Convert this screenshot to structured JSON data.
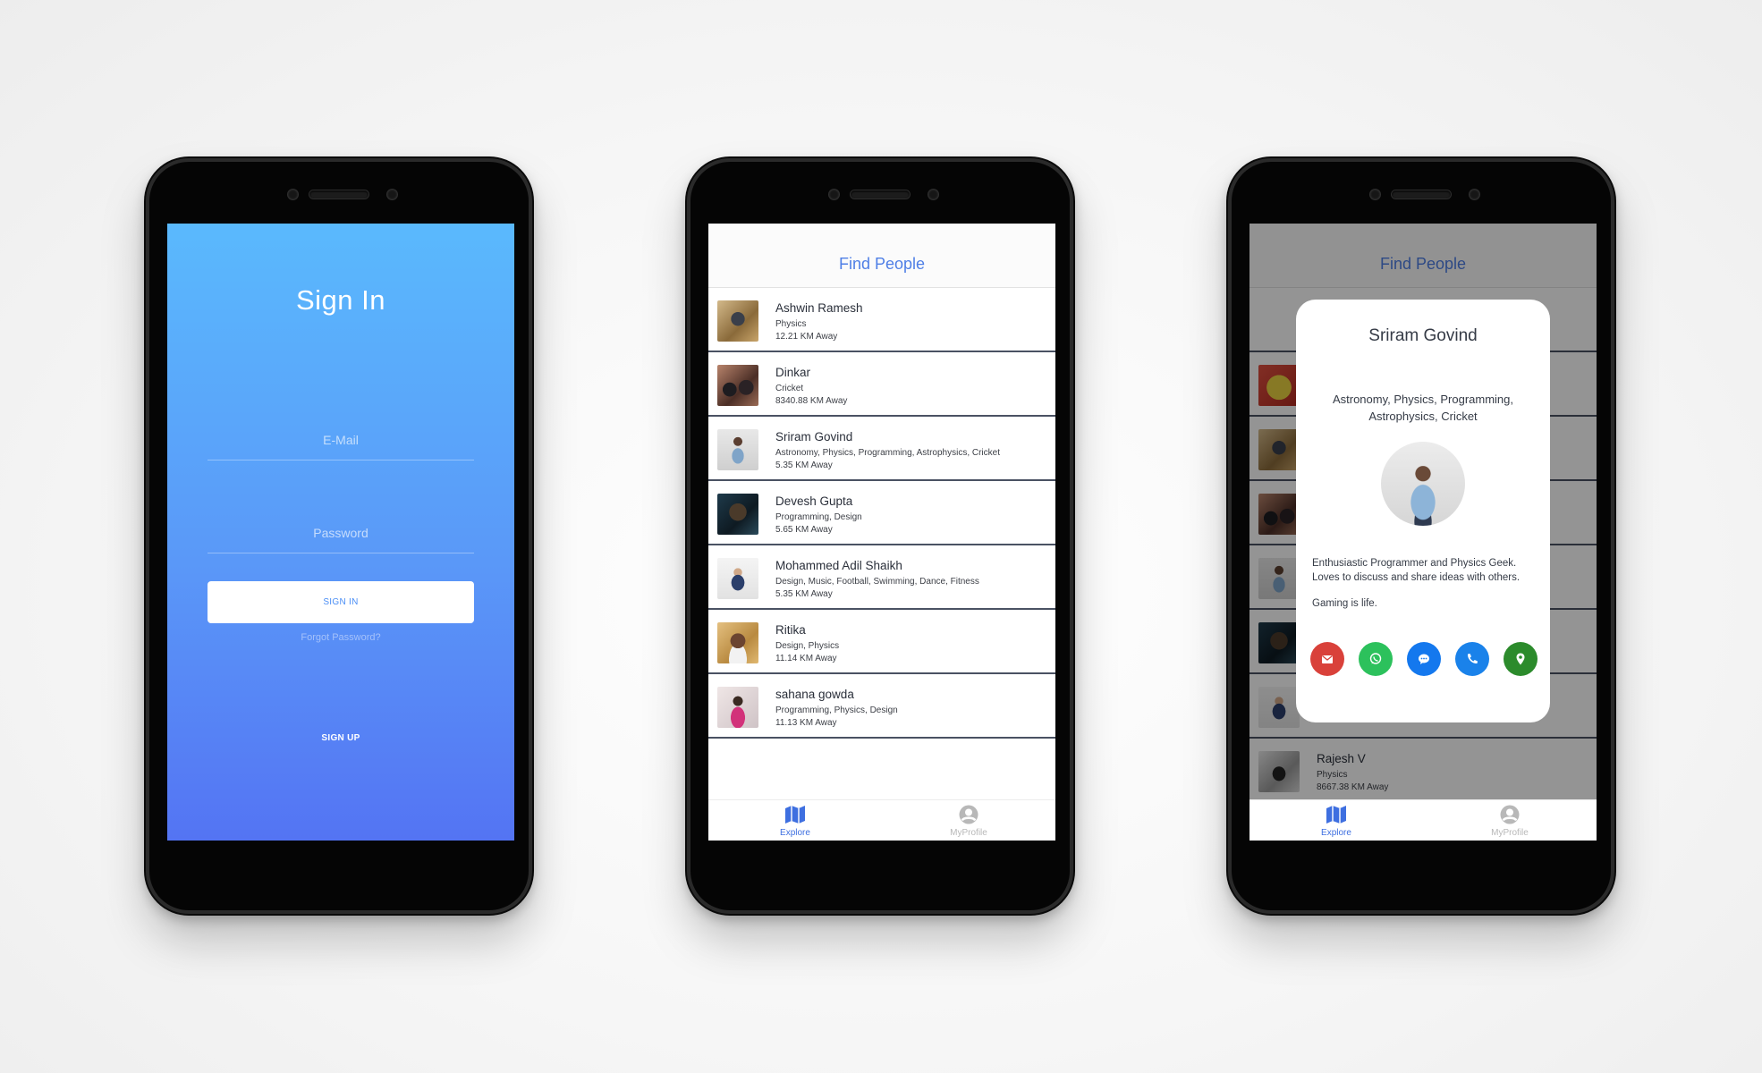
{
  "signin": {
    "title": "Sign In",
    "email_placeholder": "E-Mail",
    "password_placeholder": "Password",
    "signin_button": "SIGN IN",
    "forgot_link": "Forgot Password?",
    "signup_link": "SIGN UP"
  },
  "find_people": {
    "title": "Find People",
    "people": [
      {
        "name": "Ashwin Ramesh",
        "tags": "Physics",
        "distance": "12.21 KM Away"
      },
      {
        "name": "Dinkar",
        "tags": "Cricket",
        "distance": "8340.88 KM Away"
      },
      {
        "name": "Sriram Govind",
        "tags": "Astronomy, Physics, Programming, Astrophysics, Cricket",
        "distance": "5.35 KM Away"
      },
      {
        "name": "Devesh Gupta",
        "tags": "Programming, Design",
        "distance": "5.65 KM Away"
      },
      {
        "name": "Mohammed Adil Shaikh",
        "tags": "Design, Music, Football, Swimming, Dance, Fitness",
        "distance": "5.35 KM Away"
      },
      {
        "name": "Ritika",
        "tags": "Design, Physics",
        "distance": "11.14 KM Away"
      },
      {
        "name": "sahana gowda",
        "tags": "Programming, Physics, Design",
        "distance": "11.13 KM Away"
      }
    ]
  },
  "profile_screen": {
    "title": "Find People",
    "bottom_row": {
      "name": "Rajesh V",
      "tags": "Physics",
      "distance": "8667.38 KM Away"
    },
    "modal": {
      "name": "Sriram Govind",
      "interests": "Astronomy, Physics, Programming, Astrophysics, Cricket",
      "bio": "Enthusiastic Programmer and Physics Geek. Loves to discuss and share ideas with others.",
      "bio_extra": "Gaming is life.",
      "actions": [
        "mail-icon",
        "whatsapp-icon",
        "messenger-icon",
        "phone-icon",
        "location-icon"
      ]
    }
  },
  "tabs": {
    "explore": "Explore",
    "profile": "MyProfile"
  },
  "colors": {
    "accent": "#4f7fe6",
    "gradient_top": "#5ab9fd",
    "gradient_bottom": "#5474f3",
    "mail": "#d9413a",
    "whatsapp": "#2cc15c",
    "messenger": "#1478ee",
    "phone": "#1a82ea",
    "location": "#2c8b2c"
  }
}
